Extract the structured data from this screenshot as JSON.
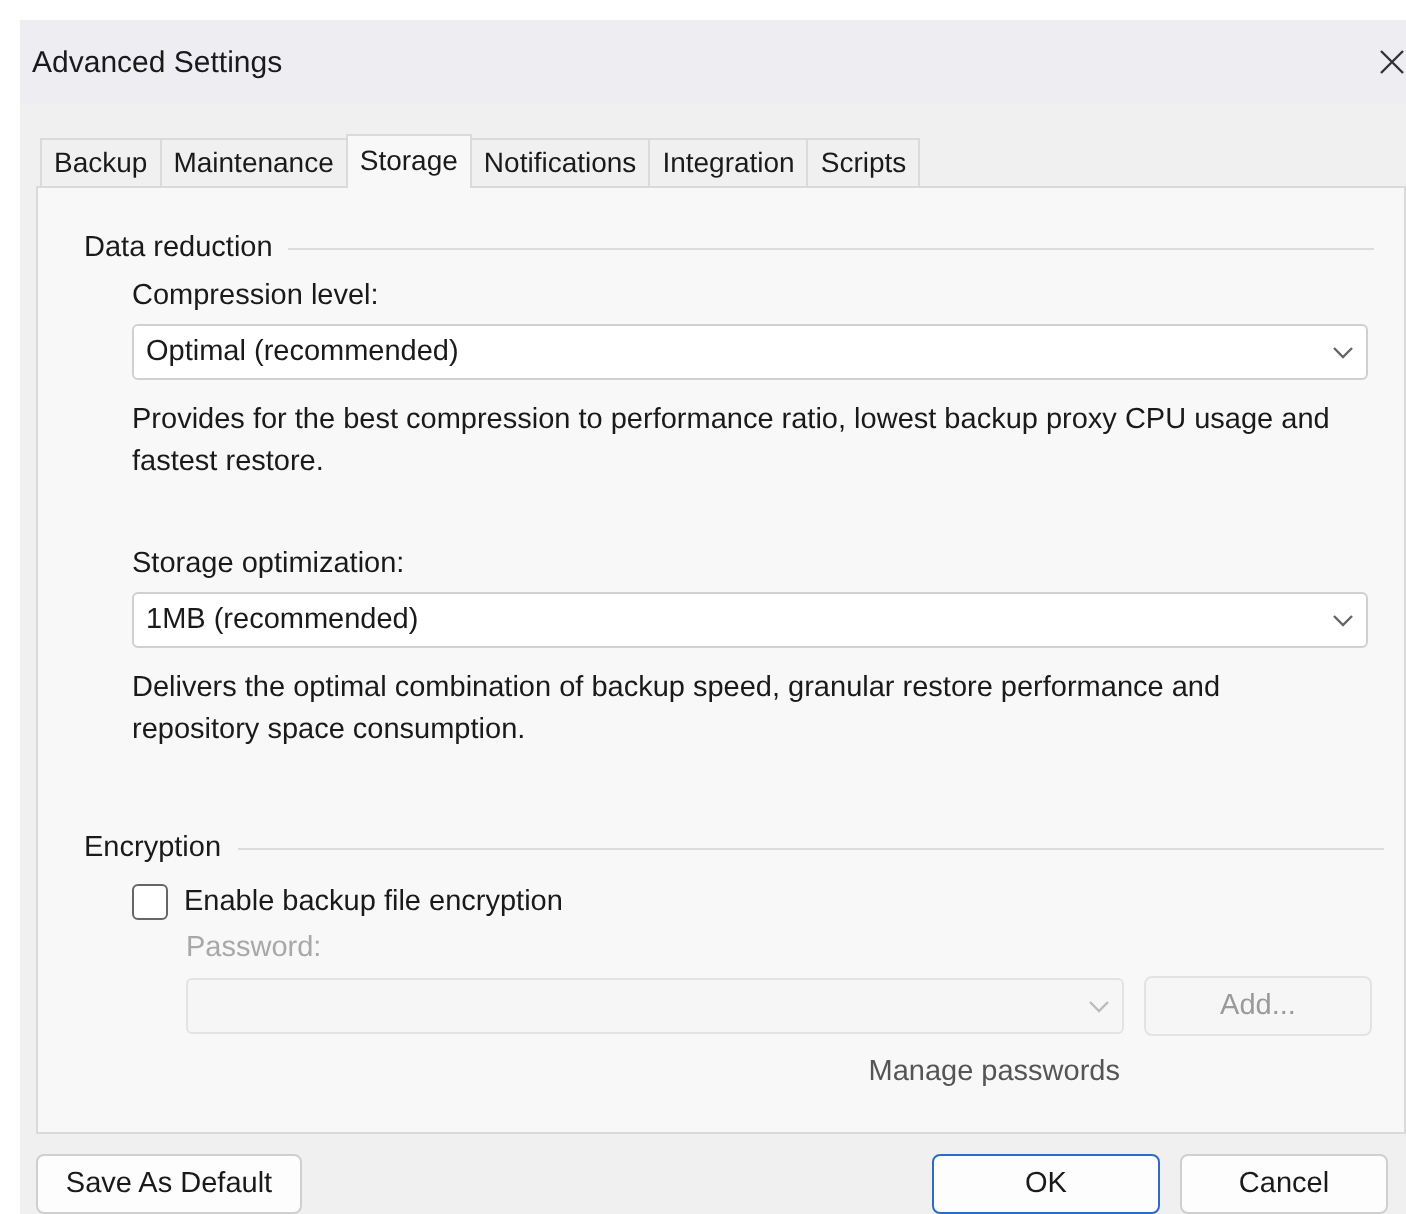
{
  "window": {
    "title": "Advanced Settings"
  },
  "tabs": [
    {
      "label": "Backup",
      "selected": false
    },
    {
      "label": "Maintenance",
      "selected": false
    },
    {
      "label": "Storage",
      "selected": true
    },
    {
      "label": "Notifications",
      "selected": false
    },
    {
      "label": "Integration",
      "selected": false
    },
    {
      "label": "Scripts",
      "selected": false
    }
  ],
  "data_reduction": {
    "heading": "Data reduction",
    "fields": [
      {
        "label": "Compression level:",
        "value": "Optimal (recommended)",
        "description": "Provides for the best compression to performance ratio, lowest backup proxy CPU usage and fastest restore."
      },
      {
        "label": "Storage optimization:",
        "value": "1MB (recommended)",
        "description": "Delivers the optimal combination of backup speed, granular restore performance and repository space consumption."
      }
    ]
  },
  "encryption": {
    "heading": "Encryption",
    "checkbox": {
      "label": "Enable backup file encryption",
      "checked": false
    },
    "password_label": "Password:",
    "password_disabled": true,
    "add_button": "Add...",
    "manage_link": "Manage passwords"
  },
  "buttons": {
    "left": "Save As Default",
    "ok": "OK",
    "cancel": "Cancel"
  }
}
